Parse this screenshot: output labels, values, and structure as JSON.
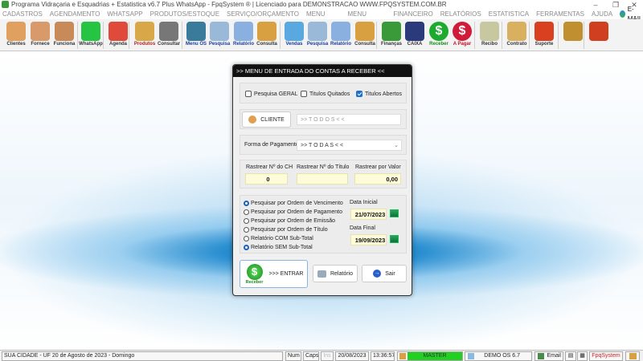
{
  "window": {
    "title": "Programa Vidraçaria e Esquadrias + Estatistica v6.7 Plus WhatsApp - FpqSystem ® | Licenciado para  DEMONSTRACAO WWW.FPQSYSTEM.COM.BR",
    "minimize": "–",
    "maximize": "❐",
    "close": "✕"
  },
  "menu": [
    "CADASTROS",
    "AGENDAMENTO",
    "WHATSAPP",
    "PRODUTOS/ESTOQUE",
    "SERVIÇO/ORÇAMENTO",
    "MENU VENDAS",
    "MENU COMPRAS",
    "FINANCEIRO",
    "RELATÓRIOS",
    "ESTATISTICA",
    "FERRAMENTAS",
    "AJUDA",
    "E-MAIL"
  ],
  "toolbar": [
    {
      "label": "Clientes",
      "icon": "clients-icon",
      "color": "#e0a060"
    },
    {
      "label": "Fornece",
      "icon": "supplier-icon",
      "color": "#d89a6a"
    },
    {
      "label": "Funciona",
      "icon": "employee-icon",
      "color": "#c98a5a"
    },
    {
      "label": "WhatsApp",
      "icon": "whatsapp-icon",
      "color": "#25c443"
    },
    {
      "label": "Agenda",
      "icon": "calendar-icon",
      "color": "#e04a3a"
    },
    {
      "label": "Produtos",
      "icon": "boxes-icon",
      "color": "#d8a848"
    },
    {
      "label": "Consultar",
      "icon": "barcode-icon",
      "color": "#777777"
    },
    {
      "label": "Menu OS",
      "icon": "clipboard-icon",
      "color": "#3a7a9a"
    },
    {
      "label": "Pesquisa",
      "icon": "search-doc-icon",
      "color": "#9ab8d8"
    },
    {
      "label": "Relatório",
      "icon": "printer-icon",
      "color": "#8ab0e0"
    },
    {
      "label": "Consulta",
      "icon": "drawer-icon",
      "color": "#d8a040"
    },
    {
      "label": "Vendas",
      "icon": "monitor-icon",
      "color": "#5aa8e0"
    },
    {
      "label": "Pesquisa",
      "icon": "search-doc-icon",
      "color": "#9ab8d8"
    },
    {
      "label": "Relatório",
      "icon": "printer-icon",
      "color": "#8ab0e0"
    },
    {
      "label": "Consulta",
      "icon": "drawer-icon",
      "color": "#d8a040"
    },
    {
      "label": "Finanças",
      "icon": "finance-icon",
      "color": "#3a9a3a"
    },
    {
      "label": "CAIXA",
      "icon": "cashbook-icon",
      "color": "#2a3a7a"
    },
    {
      "label": "Receber",
      "icon": "receive-dollar-icon",
      "color": "#1eaa2e"
    },
    {
      "label": "A Pagar",
      "icon": "pay-dollar-icon",
      "color": "#d01a3a"
    },
    {
      "label": "Recibo",
      "icon": "receipt-icon",
      "color": "#c8c8a0"
    },
    {
      "label": "Contrato",
      "icon": "contract-icon",
      "color": "#d8b060"
    },
    {
      "label": "Suporte",
      "icon": "support-icon",
      "color": "#d84020"
    },
    {
      "label": "",
      "icon": "coin-icon",
      "color": "#c09030"
    },
    {
      "label": "",
      "icon": "exit-icon",
      "color": "#d04020"
    }
  ],
  "dialog": {
    "title": ">>  MENU DE ENTRADA DO CONTAS A RECEBER  <<",
    "checks": [
      {
        "label": "Pesquisa GERAL",
        "checked": false
      },
      {
        "label": "Titulos Quitados",
        "checked": false
      },
      {
        "label": "Titulos Abertos",
        "checked": true
      }
    ],
    "cliente_button": "CLIENTE",
    "cliente_value": ">> T O D O S < <",
    "forma_label": "Forma de Pagamento",
    "forma_value": ">> T O D A S < <",
    "rastrear": [
      {
        "label": "Rastrear Nº do CH",
        "value": "0"
      },
      {
        "label": "Rastrear Nº do Título",
        "value": ""
      },
      {
        "label": "Rastrear por Valor",
        "value": "0,00"
      }
    ],
    "radios": [
      {
        "label": "Pesquisar por Ordem de Vencimento",
        "selected": true
      },
      {
        "label": "Pesquisar por Ordem de Pagamento",
        "selected": false
      },
      {
        "label": "Pesquisar por Ordem de Emissão",
        "selected": false
      },
      {
        "label": "Pesquisar por Ordem de Título",
        "selected": false
      },
      {
        "label": "Relatório COM Sub-Total",
        "selected": false
      },
      {
        "label": "Relatório SEM Sub-Total",
        "selected": true
      }
    ],
    "data_inicial_label": "Data Inicial",
    "data_inicial": "21/07/2023",
    "data_final_label": "Data Final",
    "data_final": "19/09/2023",
    "receber_label": "Receber",
    "entrar": ">>> ENTRAR",
    "relatorio": "Relatório",
    "sair": "Sair"
  },
  "status": {
    "location": "SUA CIDADE - UF 20 de Agosto de 2023 - Domingo",
    "num": "Num",
    "caps": "Caps",
    "ins": "Ins",
    "date": "20/08/2023",
    "time": "13:36:57",
    "user": "MASTER",
    "version": "DEMO OS 6.7",
    "email": "Email",
    "brand": "FpqSystem"
  }
}
